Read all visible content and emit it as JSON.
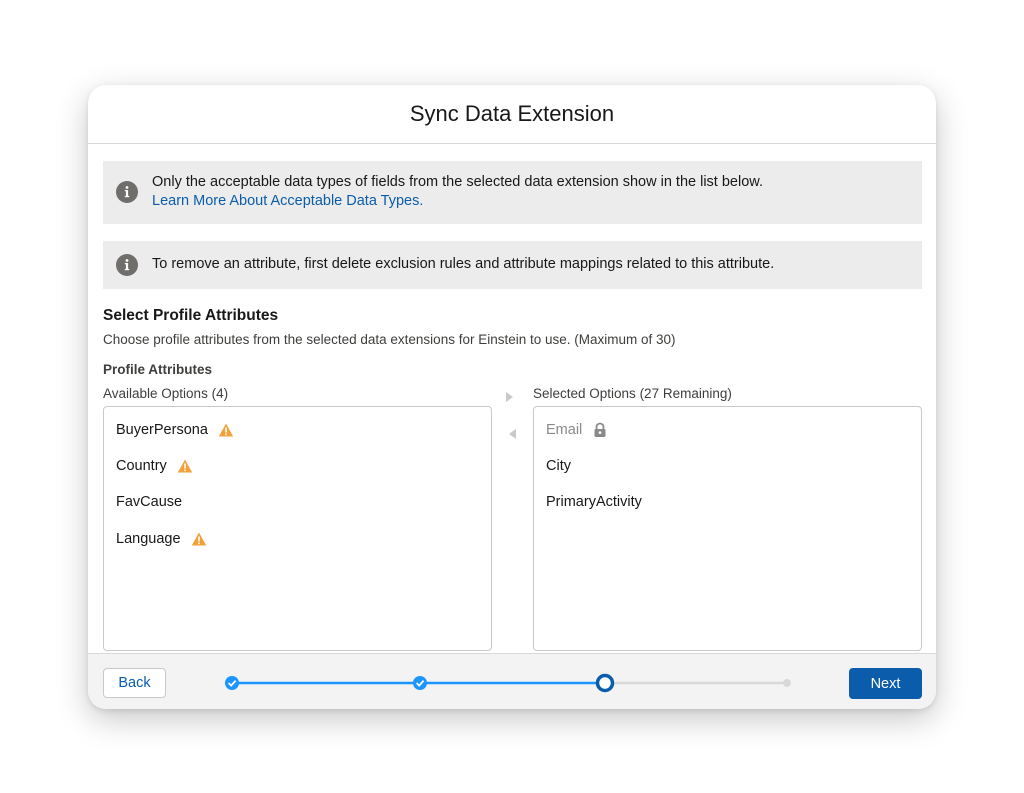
{
  "modal": {
    "title": "Sync Data Extension"
  },
  "alerts": [
    {
      "text": "Only the acceptable data types of fields from the selected data extension show in the list below.",
      "link": "Learn More About Acceptable Data Types.",
      "icon": "info-icon"
    },
    {
      "text": "To remove an attribute, first delete exclusion rules and attribute mappings related to this attribute.",
      "icon": "info-icon"
    }
  ],
  "section": {
    "title": "Select Profile Attributes",
    "description": "Choose profile attributes from the selected data extensions for Einstein to use. (Maximum of 30)",
    "field_label": "Profile Attributes"
  },
  "available": {
    "label": "Available Options (4)",
    "options": [
      {
        "name": "BuyerPersona",
        "icon": "warning-icon"
      },
      {
        "name": "Country",
        "icon": "warning-icon"
      },
      {
        "name": "FavCause",
        "icon": ""
      },
      {
        "name": "Language",
        "icon": "warning-icon"
      }
    ]
  },
  "selected": {
    "label": "Selected Options (27 Remaining)",
    "options": [
      {
        "name": "Email",
        "icon": "lock-icon",
        "locked": true
      },
      {
        "name": "City",
        "icon": ""
      },
      {
        "name": "PrimaryActivity",
        "icon": ""
      }
    ]
  },
  "footer": {
    "back_label": "Back",
    "next_label": "Next",
    "progress": {
      "steps": 4,
      "current_step": 3,
      "completed_steps": 2
    }
  },
  "colors": {
    "brand": "#0b5cab",
    "progress": "#1b96ff",
    "warning": "#f2a13a",
    "alert_bg": "#ececec"
  }
}
